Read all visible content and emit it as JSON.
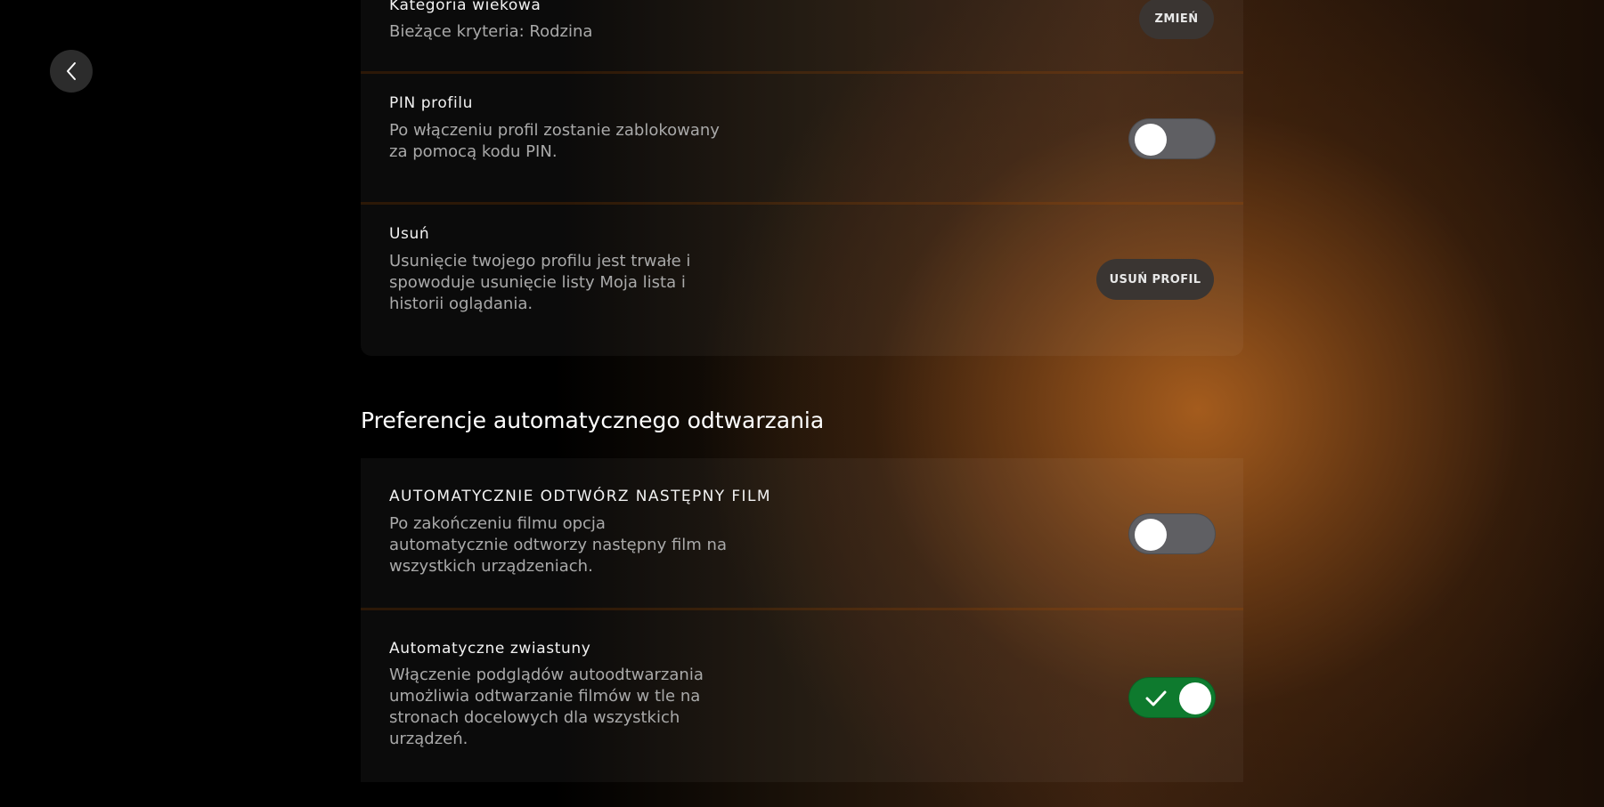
{
  "nav": {
    "back_icon": "chevron-left-icon"
  },
  "profile_settings": {
    "age_category": {
      "title": "Kategoria wiekowa",
      "description": "Bieżące kryteria: Rodzina",
      "button_label": "ZMIEŃ"
    },
    "pin": {
      "title": "PIN profilu",
      "description": "Po włączeniu profil zostanie zablokowany za pomocą kodu PIN.",
      "toggle_on": false
    },
    "delete": {
      "title": "Usuń",
      "description": "Usunięcie twojego profilu jest trwałe i spowoduje usunięcie listy Moja lista i historii oglądania.",
      "button_label": "USUŃ PROFIL"
    }
  },
  "autoplay": {
    "heading": "Preferencje automatycznego odtwarzania",
    "next_movie": {
      "title": "AUTOMATYCZNIE ODTWÓRZ NASTĘPNY FILM",
      "description": "Po zakończeniu filmu opcja automatycznie odtworzy następny film na wszystkich urządzeniach.",
      "toggle_on": false
    },
    "trailers": {
      "title": "Automatyczne zwiastuny",
      "description": "Włączenie podglądów autoodtwarzania umożliwia odtwarzanie filmów w tle na stronach docelowych dla wszystkich urządzeń.",
      "toggle_on": true
    }
  },
  "colors": {
    "toggle_off": "#5f5f63",
    "toggle_on": "#0e7a2e",
    "accent_glow": "#b0601e"
  }
}
